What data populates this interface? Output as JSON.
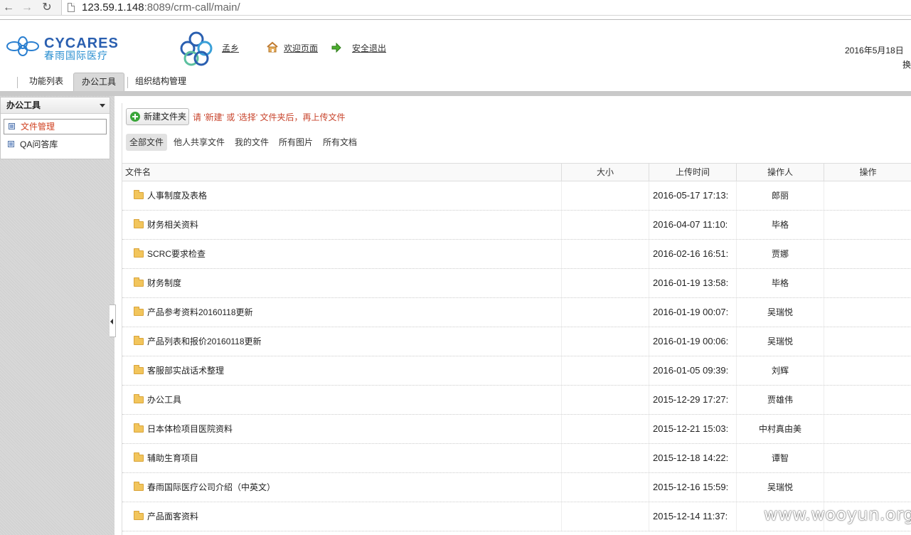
{
  "browser": {
    "url_host": "123.59.1.148",
    "url_rest": ":8089/crm-call/main/"
  },
  "header": {
    "logo_en": "CYCARES",
    "logo_cn": "春雨国际医疗",
    "user_name": "孟乡",
    "welcome_link": "欢迎页面",
    "logout_link": "安全退出",
    "date": "2016年5月18日",
    "switch": "换"
  },
  "tabs": [
    "功能列表",
    "办公工具",
    "组织结构管理"
  ],
  "sidebar": {
    "title": "办公工具",
    "items": [
      "文件管理",
      "QA问答库"
    ]
  },
  "toolbar": {
    "new_folder": "新建文件夹",
    "hint": "请 '新建' 或 '选择' 文件夹后，再上传文件"
  },
  "filters": [
    "全部文件",
    "他人共享文件",
    "我的文件",
    "所有图片",
    "所有文档"
  ],
  "table": {
    "headers": [
      "文件名",
      "大小",
      "上传时间",
      "操作人",
      "操作"
    ],
    "rows": [
      {
        "name": "人事制度及表格",
        "size": "",
        "time": "2016-05-17 17:13:",
        "op": "郎丽"
      },
      {
        "name": "财务相关资料",
        "size": "",
        "time": "2016-04-07 11:10:",
        "op": "毕格"
      },
      {
        "name": "SCRC要求检查",
        "size": "",
        "time": "2016-02-16 16:51:",
        "op": "贾娜"
      },
      {
        "name": "财务制度",
        "size": "",
        "time": "2016-01-19 13:58:",
        "op": "毕格"
      },
      {
        "name": "产品参考资料20160118更新",
        "size": "",
        "time": "2016-01-19 00:07:",
        "op": "吴瑞悦"
      },
      {
        "name": "产品列表和报价20160118更新",
        "size": "",
        "time": "2016-01-19 00:06:",
        "op": "吴瑞悦"
      },
      {
        "name": "客服部实战话术整理",
        "size": "",
        "time": "2016-01-05 09:39:",
        "op": "刘辉"
      },
      {
        "name": "办公工具",
        "size": "",
        "time": "2015-12-29 17:27:",
        "op": "贾雄伟"
      },
      {
        "name": "日本体检项目医院资料",
        "size": "",
        "time": "2015-12-21 15:03:",
        "op": "中村真由美"
      },
      {
        "name": "辅助生育项目",
        "size": "",
        "time": "2015-12-18 14:22:",
        "op": "谭智"
      },
      {
        "name": "春雨国际医疗公司介绍（中英文）",
        "size": "",
        "time": "2015-12-16 15:59:",
        "op": "吴瑞悦"
      },
      {
        "name": "产品面客资料",
        "size": "",
        "time": "2015-12-14 11:37:",
        "op": ""
      }
    ]
  },
  "watermark": "www.wooyun.org",
  "colors": {
    "accent_red": "#c8442c",
    "logo_blue": "#2a5fb0",
    "folder_yellow": "#f2c55c"
  }
}
